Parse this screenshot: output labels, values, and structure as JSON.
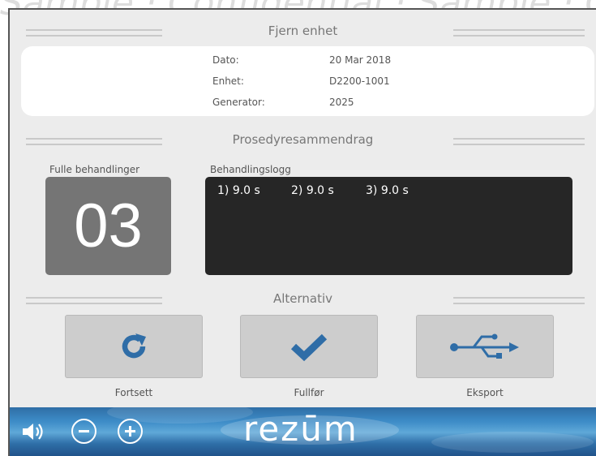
{
  "header": {
    "title": "Fjern enhet"
  },
  "device_info": [
    {
      "label": "Dato:",
      "value": "20 Mar 2018"
    },
    {
      "label": "Enhet:",
      "value": "D2200-1001"
    },
    {
      "label": "Generator:",
      "value": "2025"
    }
  ],
  "summary": {
    "title": "Prosedyresammendrag",
    "count_label": "Fulle behandlinger",
    "count_value": "03",
    "log_label": "Behandlingslogg",
    "log_entries": [
      "1) 9.0 s",
      "2) 9.0 s",
      "3) 9.0 s"
    ]
  },
  "options": {
    "title": "Alternativ",
    "buttons": [
      {
        "label": "Fortsett",
        "icon": "refresh-icon"
      },
      {
        "label": "Fullfør",
        "icon": "checkmark-icon"
      },
      {
        "label": "Eksport",
        "icon": "usb-icon"
      }
    ]
  },
  "footer": {
    "brand": "rezūm",
    "controls": [
      "speaker-icon",
      "minus-icon",
      "plus-icon"
    ]
  },
  "colors": {
    "accent": "#2f6da7",
    "count_box": "#757575",
    "log_box": "#262626",
    "panel": "#ececec"
  }
}
